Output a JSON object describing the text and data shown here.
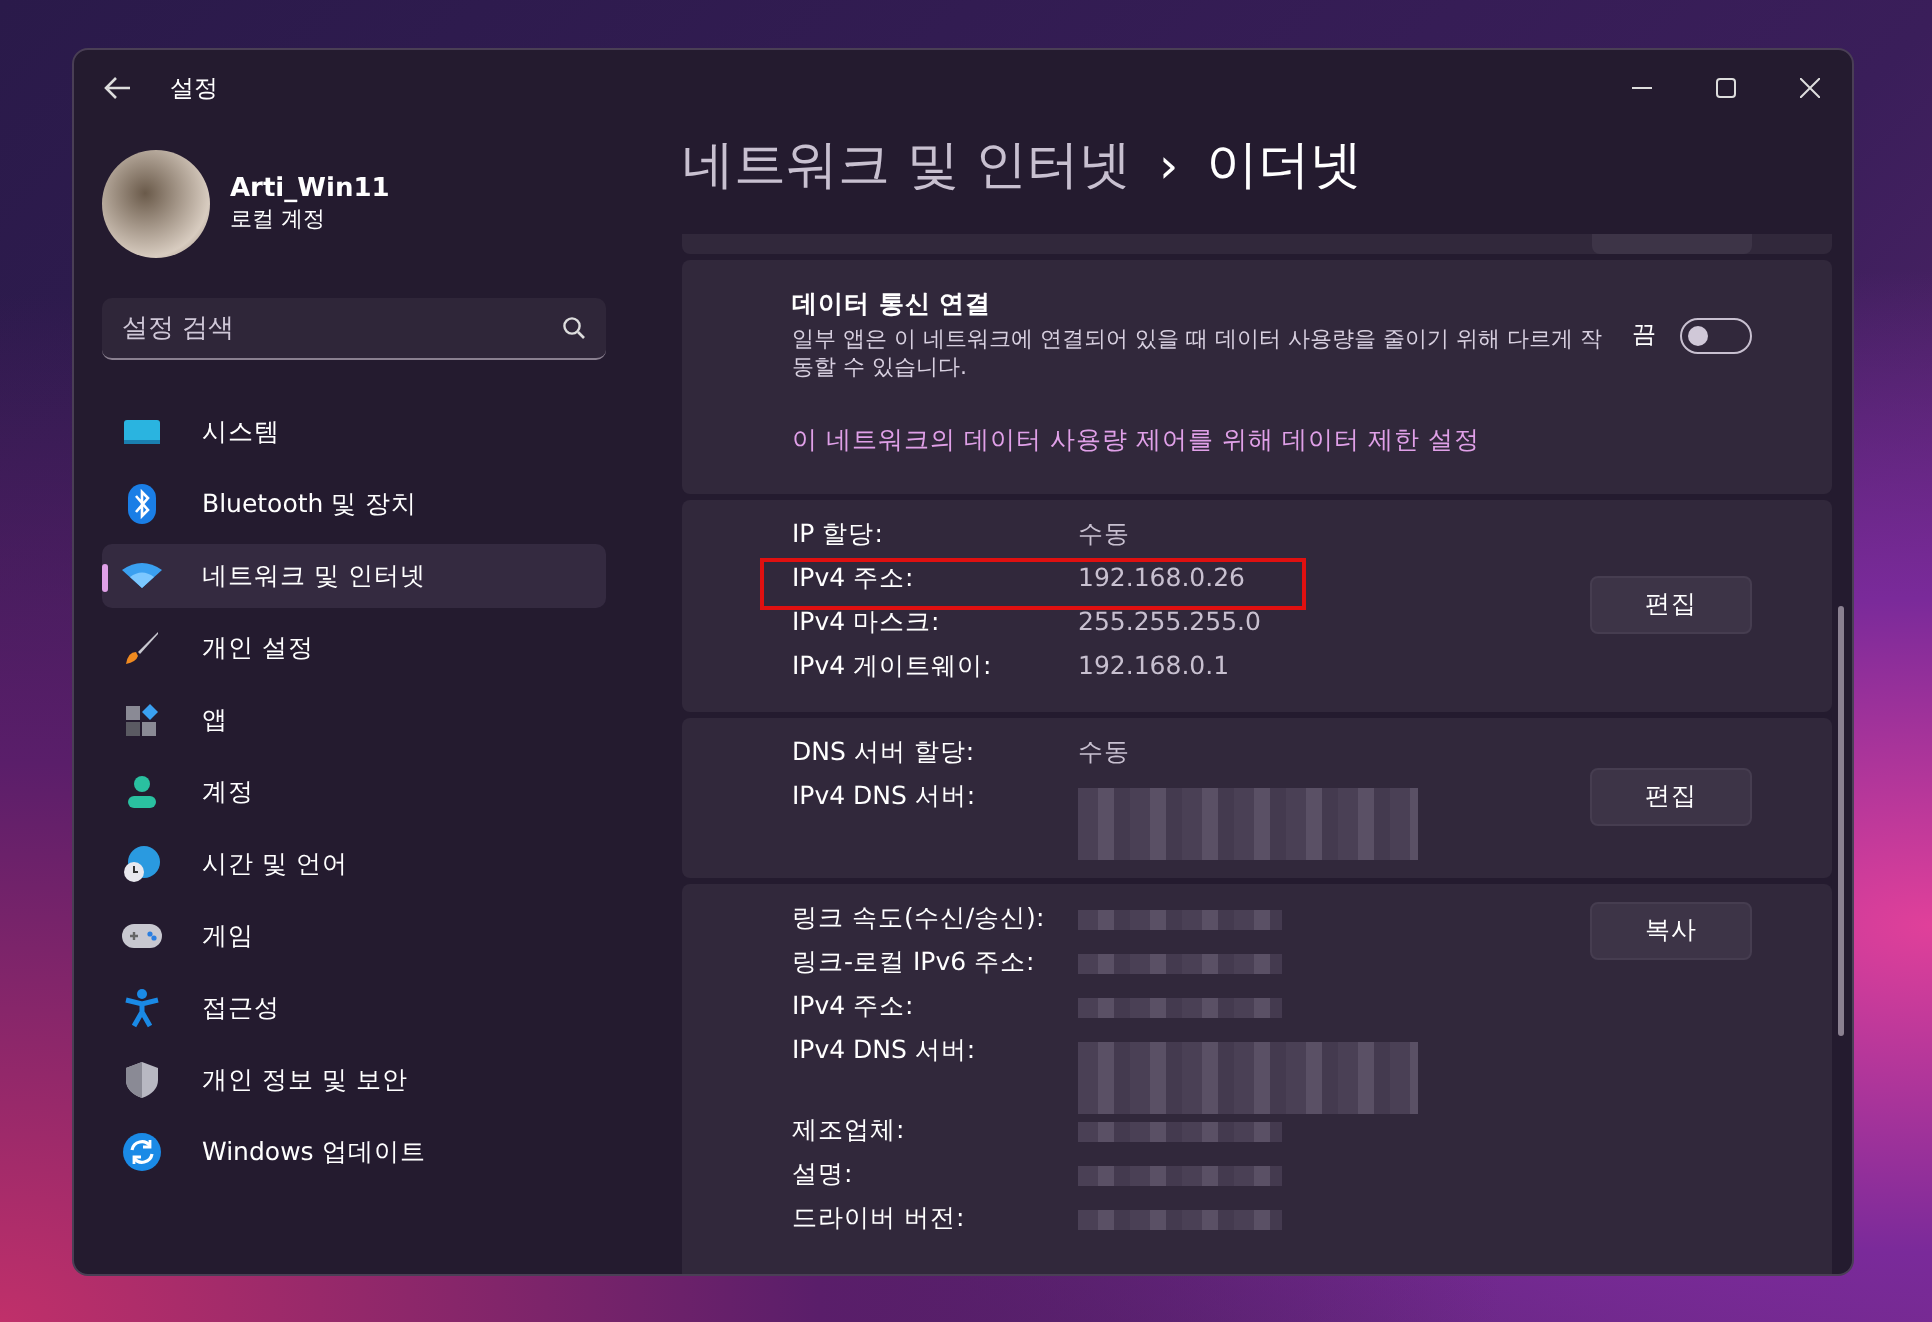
{
  "window": {
    "title": "설정"
  },
  "account": {
    "name": "Arti_Win11",
    "type": "로컬 계정"
  },
  "search": {
    "placeholder": "설정 검색"
  },
  "sidebar": {
    "items": [
      {
        "label": "시스템",
        "selected": false
      },
      {
        "label": "Bluetooth 및 장치",
        "selected": false
      },
      {
        "label": "네트워크 및 인터넷",
        "selected": true
      },
      {
        "label": "개인 설정",
        "selected": false
      },
      {
        "label": "앱",
        "selected": false
      },
      {
        "label": "계정",
        "selected": false
      },
      {
        "label": "시간 및 언어",
        "selected": false
      },
      {
        "label": "게임",
        "selected": false
      },
      {
        "label": "접근성",
        "selected": false
      },
      {
        "label": "개인 정보 및 보안",
        "selected": false
      },
      {
        "label": "Windows 업데이트",
        "selected": false
      }
    ]
  },
  "breadcrumb": {
    "parent": "네트워크 및 인터넷",
    "separator": "›",
    "current": "이더넷"
  },
  "metered": {
    "title": "데이터 통신 연결",
    "description": "일부 앱은 이 네트워크에 연결되어 있을 때 데이터 사용량을 줄이기 위해 다르게 작동할 수 있습니다.",
    "state_label": "끔",
    "on": false,
    "link": "이 네트워크의 데이터 사용량 제어를 위해 데이터 제한 설정"
  },
  "sections": [
    {
      "button": "편집",
      "rows": [
        {
          "label": "IP 할당:",
          "kind": "text",
          "value": "수동",
          "highlighted": false
        },
        {
          "label": "IPv4 주소:",
          "kind": "text",
          "value": "192.168.0.26",
          "highlighted": true
        },
        {
          "label": "IPv4 마스크:",
          "kind": "text",
          "value": "255.255.255.0",
          "highlighted": false
        },
        {
          "label": "IPv4 게이트웨이:",
          "kind": "text",
          "value": "192.168.0.1",
          "highlighted": false
        }
      ]
    },
    {
      "button": "편집",
      "rows": [
        {
          "label": "DNS 서버 할당:",
          "kind": "text",
          "value": "수동"
        },
        {
          "label": "IPv4 DNS 서버:",
          "kind": "blurred-tall"
        }
      ]
    },
    {
      "button": "복사",
      "rows": [
        {
          "label": "링크 속도(수신/송신):",
          "kind": "blurred"
        },
        {
          "label": "링크-로컬 IPv6 주소:",
          "kind": "blurred"
        },
        {
          "label": "IPv4 주소:",
          "kind": "blurred"
        },
        {
          "label": "IPv4 DNS 서버:",
          "kind": "blurred-tall"
        },
        {
          "label": "제조업체:",
          "kind": "blurred"
        },
        {
          "label": "설명:",
          "kind": "blurred"
        },
        {
          "label": "드라이버 버전:",
          "kind": "blurred"
        }
      ]
    }
  ]
}
